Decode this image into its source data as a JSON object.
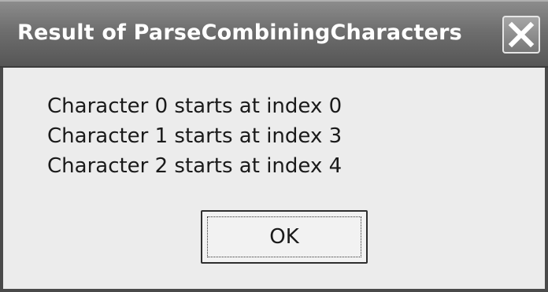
{
  "window": {
    "title": "Result of ParseCombiningCharacters",
    "close_icon": "close-x-icon"
  },
  "message": {
    "lines": [
      "Character 0 starts at index 0",
      "Character 1 starts at index 3",
      "Character 2 starts at index 4"
    ]
  },
  "buttons": {
    "ok_label": "OK"
  }
}
